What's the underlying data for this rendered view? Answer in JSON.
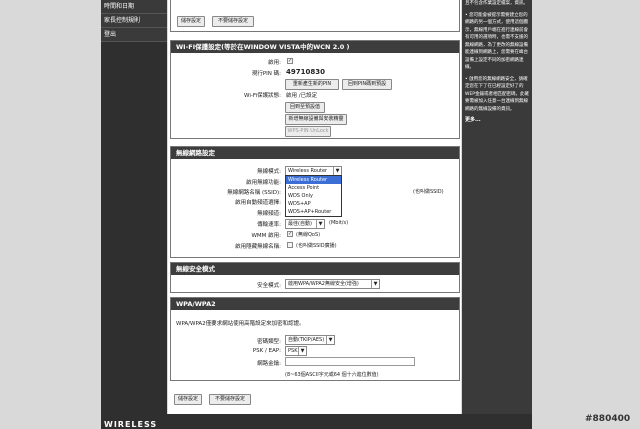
{
  "nav": [
    "時間和日期",
    "家長控制規則",
    "登出"
  ],
  "top_panel": {
    "save": "儲存設定",
    "nosave": "不要儲存設定"
  },
  "wps": {
    "title": "WI-FI保護設定(等於在WINDOW VISTA中的WCN 2.0 )",
    "enable_label": "啟用:",
    "pin_label": "現行PIN 碼:",
    "pin_value": "49710830",
    "gen_pin": "重新產生新的PIN",
    "reset_pin": "回到PIN碼到預設",
    "status_label": "Wi-Fi保護狀態:",
    "status_value": "啟用 /已設定",
    "reset_default": "回到至預設值",
    "add_device": "新增無線設備與安裝精靈",
    "pin_unlock": "WPS-PIN UnLock"
  },
  "wireless": {
    "title": "無線網路設定",
    "mode_label": "無線模式:",
    "mode_value": "Wireless Router",
    "mode_options": [
      "Wireless Router",
      "Access Point",
      "WDS Only",
      "WDS+AP",
      "WDS+AP+Router"
    ],
    "enable_label": "啟用無線功能:",
    "ssid_label": "無線網路名稱 (SSID):",
    "ssid_note": "(也叫做SSID)",
    "autochan_label": "啟用自動頻道選擇:",
    "chan_label": "無線頻道:",
    "rate_label": "傳輸速率:",
    "rate_value": "最佳(自動)",
    "rate_unit": "(Mbit/s)",
    "wmm_label": "WMM 啟用:",
    "wmm_note": "(無線QoS)",
    "hidden_label": "啟用隱藏無線名稱:",
    "hidden_note": "(也叫做SSID廣播)"
  },
  "security": {
    "title": "無線安全模式",
    "mode_label": "安全模式:",
    "mode_value": "啟用WPA/WPA2無線安全(增強)"
  },
  "wpa": {
    "title": "WPA/WPA2",
    "desc": "WPA/WPA2僅要求網站使用高階設定來加密和認證。",
    "cipher_label": "密碼類型:",
    "cipher_value": "自動(TKIP/AES)",
    "psk_label": "PSK / EAP:",
    "psk_value": "PSK",
    "key_label": "網路金鑰:",
    "key_note": "(8~63個ASCII字元或64 個十六進位數值)"
  },
  "bottom": {
    "save": "儲存設定",
    "nosave": "不要儲存設定"
  },
  "sidebar": {
    "p1": "且不包含作業設定檔案，資訊。",
    "p2": "• 您可能會被提示需要建立您的網路的另一個方式，使用這個圖示，無線用戶端在進行連線前會有可用的選項時，也需不支援的無線網路，為了更改的無線設備能連線到網路上，您需要在峰台設備上設定不同的加密網路連線。",
    "p3": "• 啟用您的無線網路安全，請確定您在下了在已經設定好了的WEP金鑰或者相匹配密碼，此確要需被加入任意一台連線到無線網路的無線設備的資訊。",
    "more": "更多..."
  },
  "brand": "WIRELESS",
  "watermark": "#880400"
}
